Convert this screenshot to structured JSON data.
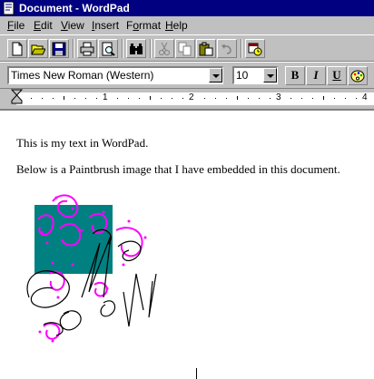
{
  "window": {
    "title": "Document - WordPad"
  },
  "menu": [
    {
      "label": "File",
      "accel": "F",
      "rest": "ile"
    },
    {
      "label": "Edit",
      "accel": "E",
      "rest": "dit"
    },
    {
      "label": "View",
      "accel": "V",
      "rest": "iew"
    },
    {
      "label": "Insert",
      "accel": "I",
      "rest": "nsert"
    },
    {
      "label": "Format",
      "pre": "F",
      "accel": "o",
      "rest": "rmat"
    },
    {
      "label": "Help",
      "accel": "H",
      "rest": "elp"
    }
  ],
  "toolbar": {
    "buttons": [
      "new-icon",
      "open-icon",
      "save-icon",
      "print-icon",
      "print-preview-icon",
      "find-icon",
      "cut-icon",
      "copy-icon",
      "paste-icon",
      "undo-icon",
      "insert-date-time-icon"
    ]
  },
  "format": {
    "font": "Times New Roman (Western)",
    "size": "10",
    "bold": "B",
    "italic": "I",
    "underline": "U"
  },
  "ruler": {
    "numbers": [
      "1",
      "2",
      "3",
      "4"
    ]
  },
  "document": {
    "line1": "This is my text in WordPad.",
    "line2": "Below is a Paintbrush image that I have embedded in this document."
  },
  "colors": {
    "title_bar": "#000080",
    "face": "#c0c0c0",
    "image_fill": "#008080",
    "scribble": "#ff00ff"
  }
}
